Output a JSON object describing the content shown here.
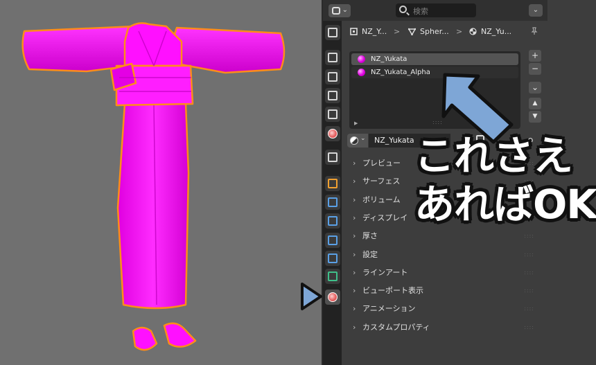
{
  "header": {
    "search_placeholder": "検索",
    "editor_type_icon": "properties-editor-icon",
    "options_icon": "chevron-down-icon"
  },
  "breadcrumb": {
    "object": "NZ_Y...",
    "mesh": "Spher...",
    "material": "NZ_Yu...",
    "separator": ">"
  },
  "material_slots": [
    {
      "name": "NZ_Yukata",
      "active": true
    },
    {
      "name": "NZ_Yukata_Alpha",
      "active": false
    }
  ],
  "slot_buttons": {
    "add": "+",
    "remove": "−",
    "specials": "⌄",
    "up": "▲",
    "down": "▼"
  },
  "material": {
    "name": "NZ_Yukata"
  },
  "panels": [
    "プレビュー",
    "サーフェス",
    "ボリューム",
    "ディスプレイ",
    "厚さ",
    "設定",
    "ラインアート",
    "ビューポート表示",
    "アニメーション",
    "カスタムプロパティ"
  ],
  "tabs": [
    {
      "name": "tool-tab",
      "icon": "tool-icon",
      "color": "#d8d8d8"
    },
    {
      "name": "render-tab",
      "icon": "render-icon",
      "color": "#d8d8d8"
    },
    {
      "name": "output-tab",
      "icon": "output-icon",
      "color": "#d8d8d8"
    },
    {
      "name": "view-layer-tab",
      "icon": "view-layer-icon",
      "color": "#d8d8d8"
    },
    {
      "name": "scene-tab",
      "icon": "scene-icon",
      "color": "#d8d8d8"
    },
    {
      "name": "world-tab",
      "icon": "world-icon",
      "color": "#e25a5a"
    },
    {
      "name": "collection-tab",
      "icon": "collection-icon",
      "color": "#d8d8d8"
    },
    {
      "name": "object-tab",
      "icon": "object-icon",
      "color": "#f0a030"
    },
    {
      "name": "modifier-tab",
      "icon": "modifier-icon",
      "color": "#5aa0e6"
    },
    {
      "name": "particles-tab",
      "icon": "particles-icon",
      "color": "#5aa0e6"
    },
    {
      "name": "physics-tab",
      "icon": "physics-icon",
      "color": "#5aa0e6"
    },
    {
      "name": "constraints-tab",
      "icon": "constraints-icon",
      "color": "#5aa0e6"
    },
    {
      "name": "data-tab",
      "icon": "mesh-data-icon",
      "color": "#3fc08a"
    },
    {
      "name": "material-tab",
      "icon": "material-icon",
      "color": "#e25a5a"
    }
  ],
  "annotation": {
    "line1": "これさえ",
    "line2": "あればOK",
    "arrow_color": "#7ea6d6"
  },
  "colors": {
    "kimono": "#ff00ff",
    "outline": "#ff8c1a",
    "viewport_bg": "#707070"
  }
}
